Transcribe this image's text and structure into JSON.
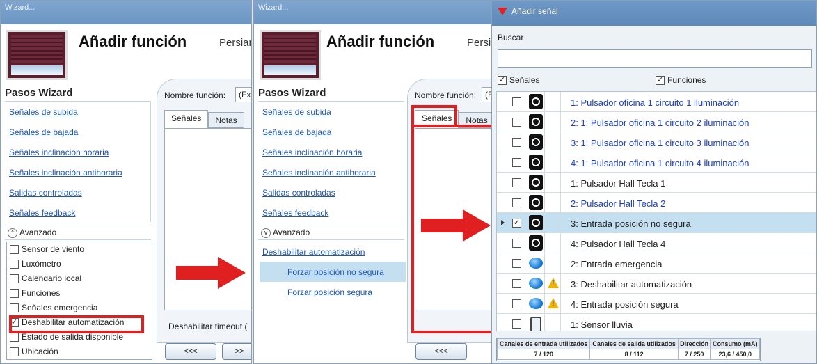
{
  "wizard_title": "Wizard...",
  "header_title": "Añadir función",
  "header_subtitle_w1": "Persian",
  "header_subtitle_w2": "Persia",
  "steps_title": "Pasos Wizard",
  "steps": [
    "Señales de subida",
    "Señales de bajada",
    "Señales inclinación horaria",
    "Señales inclinación antihoraria",
    "Salidas controladas",
    "Señales feedback"
  ],
  "advanced_label": "Avanzado",
  "advanced_items": [
    {
      "label": "Sensor de viento",
      "checked": false
    },
    {
      "label": "Luxómetro",
      "checked": false
    },
    {
      "label": "Calendario local",
      "checked": false
    },
    {
      "label": "Funciones",
      "checked": false
    },
    {
      "label": "Señales emergencia",
      "checked": false
    },
    {
      "label": "Deshabilitar automatización",
      "checked": true
    },
    {
      "label": "Estado de salida disponible",
      "checked": false
    },
    {
      "label": "Ubicación",
      "checked": false
    }
  ],
  "w2_advanced_link": "Deshabilitar automatización",
  "w2_sub_items": [
    "Forzar posición no segura",
    "Forzar posición segura"
  ],
  "function_name_label": "Nombre función:",
  "function_name_value_w1": "(Fx)",
  "function_name_value_w2": "(F",
  "tabs": [
    "Señales",
    "Notas"
  ],
  "timeout_label_w1": "Deshabilitar timeout (",
  "back_button": "<<<",
  "next_button_w1": ">>",
  "signal_dialog": {
    "title": "Añadir señal",
    "search_label": "Buscar",
    "search_value": "",
    "filter_signals": "Señales",
    "filter_functions": "Funciones",
    "rows": [
      {
        "label": "1: Pulsador oficina 1 circuito 1 iluminación",
        "icon": "pushbutton-icon",
        "warn": false,
        "blue": true,
        "checked": false,
        "selected": false
      },
      {
        "label": "2: 1: Pulsador oficina 1 circuito 2 iluminación",
        "icon": "pushbutton-icon",
        "warn": false,
        "blue": true,
        "checked": false,
        "selected": false
      },
      {
        "label": "3: 1: Pulsador oficina 1 circuito 3 iluminación",
        "icon": "pushbutton-icon",
        "warn": false,
        "blue": true,
        "checked": false,
        "selected": false
      },
      {
        "label": "4: 1: Pulsador oficina 1 circuito 4 iluminación",
        "icon": "pushbutton-icon",
        "warn": false,
        "blue": true,
        "checked": false,
        "selected": false
      },
      {
        "label": "1: Pulsador Hall Tecla 1",
        "icon": "pushbutton-icon",
        "warn": false,
        "blue": false,
        "checked": false,
        "selected": false
      },
      {
        "label": "2: Pulsador Hall Tecla 2",
        "icon": "pushbutton-icon",
        "warn": false,
        "blue": true,
        "checked": false,
        "selected": false
      },
      {
        "label": "3: Entrada posición no segura",
        "icon": "pushbutton-icon",
        "warn": false,
        "blue": false,
        "checked": true,
        "selected": true
      },
      {
        "label": "4: Pulsador Hall Tecla 4",
        "icon": "pushbutton-icon",
        "warn": false,
        "blue": false,
        "checked": false,
        "selected": false
      },
      {
        "label": "2: Entrada emergencia",
        "icon": "emergency-button-icon",
        "warn": false,
        "blue": false,
        "checked": false,
        "selected": false
      },
      {
        "label": "3: Deshabilitar automatización",
        "icon": "emergency-button-icon",
        "warn": true,
        "blue": false,
        "checked": false,
        "selected": false
      },
      {
        "label": "4: Entrada posición segura",
        "icon": "emergency-button-icon",
        "warn": true,
        "blue": false,
        "checked": false,
        "selected": false
      },
      {
        "label": "1: Sensor lluvia",
        "icon": "rain-sensor-icon",
        "warn": false,
        "blue": false,
        "checked": false,
        "selected": false
      }
    ],
    "stats_headers": [
      "Canales de entrada utilizados",
      "Canales de salida utilizados",
      "Dirección",
      "Consumo (mA)"
    ],
    "stats_values": [
      "7 / 120",
      "8 / 112",
      "7 / 250",
      "23,6 / 450,0"
    ]
  },
  "colors": {
    "accent_red": "#e02020",
    "link_blue": "#1f56b8",
    "selected_row": "#c4dff0"
  }
}
